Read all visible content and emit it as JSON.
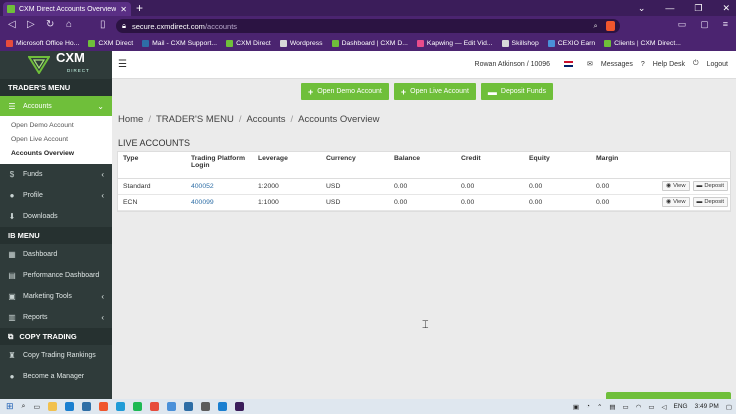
{
  "browser": {
    "tab_title": "CXM Direct Accounts Overview",
    "url_host": "secure.cxmdirect.com",
    "url_path": "/accounts",
    "bookmarks": [
      {
        "label": "Microsoft Office Ho...",
        "color": "#e74c3c"
      },
      {
        "label": "CXM Direct",
        "color": "#6fbf3a"
      },
      {
        "label": "Mail - CXM Support...",
        "color": "#2e6ea6"
      },
      {
        "label": "CXM Direct",
        "color": "#6fbf3a"
      },
      {
        "label": "Wordpress",
        "color": "#d9d9d9"
      },
      {
        "label": "Dashboard | CXM D...",
        "color": "#6fbf3a"
      },
      {
        "label": "Kapwing — Edit Vid...",
        "color": "#e84c8b"
      },
      {
        "label": "Skillshop",
        "color": "#d9d9d9"
      },
      {
        "label": "CEXIO Earn",
        "color": "#4a90d9"
      },
      {
        "label": "Clients | CXM Direct...",
        "color": "#6fbf3a"
      }
    ]
  },
  "header": {
    "logo_text": "CXM",
    "logo_sub": "DIRECT",
    "user": "Rowan Atkinson / 10096",
    "messages": "Messages",
    "help": "Help Desk",
    "logout": "Logout"
  },
  "sidebar": {
    "traders_menu": "TRADER'S MENU",
    "accounts": "Accounts",
    "sub": [
      "Open Demo Account",
      "Open Live Account",
      "Accounts Overview"
    ],
    "funds": "Funds",
    "profile": "Profile",
    "downloads": "Downloads",
    "ib_menu": "IB MENU",
    "dashboard": "Dashboard",
    "performance": "Performance Dashboard",
    "marketing": "Marketing Tools",
    "reports": "Reports",
    "copy_trading": "COPY TRADING",
    "copy_rankings": "Copy Trading Rankings",
    "become_manager": "Become a Manager"
  },
  "actions": {
    "demo": "Open Demo Account",
    "live": "Open Live Account",
    "deposit": "Deposit Funds"
  },
  "breadcrumb": [
    "Home",
    "TRADER'S MENU",
    "Accounts",
    "Accounts Overview"
  ],
  "section_title": "LIVE ACCOUNTS",
  "table": {
    "headers": [
      "Type",
      "Trading Platform Login",
      "Leverage",
      "Currency",
      "Balance",
      "Credit",
      "Equity",
      "Margin"
    ],
    "rows": [
      [
        "Standard",
        "400052",
        "1:2000",
        "USD",
        "0.00",
        "0.00",
        "0.00",
        "0.00"
      ],
      [
        "ECN",
        "400099",
        "1:1000",
        "USD",
        "0.00",
        "0.00",
        "0.00",
        "0.00"
      ]
    ],
    "view_label": "View",
    "deposit_label": "Deposit"
  },
  "taskbar": {
    "lang": "ENG",
    "time": "3:49 PM"
  },
  "colors": {
    "accent": "#6fbf3a",
    "sidebar": "#2f3b3a",
    "browser": "#4b2470"
  }
}
